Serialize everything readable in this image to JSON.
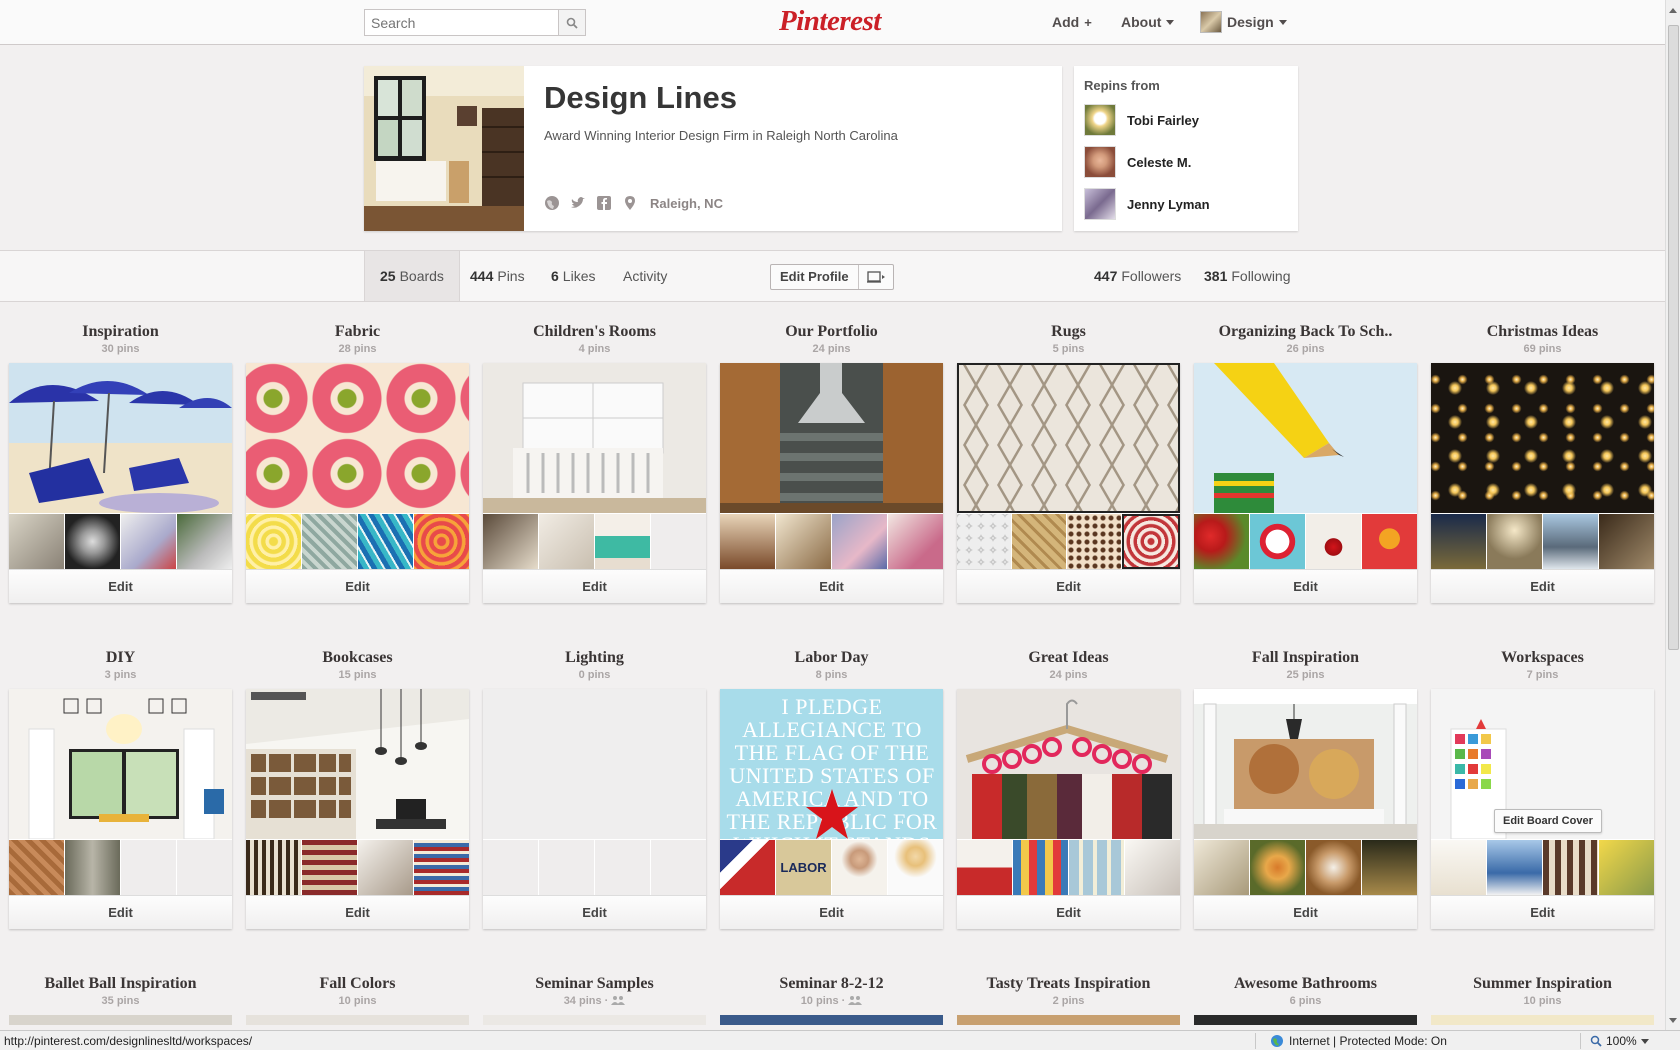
{
  "header": {
    "search_placeholder": "Search",
    "logo": "Pinterest",
    "nav_add": "Add",
    "nav_add_plus": "+",
    "nav_about": "About",
    "nav_user": "Design"
  },
  "profile": {
    "name": "Design Lines",
    "description": "Award Winning Interior Design Firm in Raleigh North Carolina",
    "location": "Raleigh, NC"
  },
  "repins": {
    "title": "Repins from",
    "users": [
      {
        "name": "Tobi Fairley"
      },
      {
        "name": "Celeste M."
      },
      {
        "name": "Jenny Lyman"
      }
    ]
  },
  "tabs": {
    "boards_count": "25",
    "boards_label": "Boards",
    "pins_count": "444",
    "pins_label": "Pins",
    "likes_count": "6",
    "likes_label": "Likes",
    "activity_label": "Activity",
    "edit_profile": "Edit Profile",
    "followers_count": "447",
    "followers_label": "Followers",
    "following_count": "381",
    "following_label": "Following"
  },
  "boards": [
    {
      "title": "Inspiration",
      "count": "30 pins",
      "edit": "Edit"
    },
    {
      "title": "Fabric",
      "count": "28 pins",
      "edit": "Edit"
    },
    {
      "title": "Children's Rooms",
      "count": "4 pins",
      "edit": "Edit"
    },
    {
      "title": "Our Portfolio",
      "count": "24 pins",
      "edit": "Edit"
    },
    {
      "title": "Rugs",
      "count": "5 pins",
      "edit": "Edit"
    },
    {
      "title": "Organizing Back To Sch..",
      "count": "26 pins",
      "edit": "Edit"
    },
    {
      "title": "Christmas Ideas",
      "count": "69 pins",
      "edit": "Edit"
    },
    {
      "title": "DIY",
      "count": "3 pins",
      "edit": "Edit"
    },
    {
      "title": "Bookcases",
      "count": "15 pins",
      "edit": "Edit"
    },
    {
      "title": "Lighting",
      "count": "0 pins",
      "edit": "Edit"
    },
    {
      "title": "Labor Day",
      "count": "8 pins",
      "edit": "Edit"
    },
    {
      "title": "Great Ideas",
      "count": "24 pins",
      "edit": "Edit"
    },
    {
      "title": "Fall Inspiration",
      "count": "25 pins",
      "edit": "Edit"
    },
    {
      "title": "Workspaces",
      "count": "7 pins",
      "edit": "Edit"
    },
    {
      "title": "Ballet Ball Inspiration",
      "count": "35 pins"
    },
    {
      "title": "Fall Colors",
      "count": "10 pins"
    },
    {
      "title": "Seminar Samples",
      "count": "34 pins ·"
    },
    {
      "title": "Seminar 8-2-12",
      "count": "10 pins ·"
    },
    {
      "title": "Tasty Treats Inspiration",
      "count": "2 pins"
    },
    {
      "title": "Awesome Bathrooms",
      "count": "6 pins"
    },
    {
      "title": "Summer Inspiration",
      "count": "10 pins"
    }
  ],
  "labor_day_poster": "I PLEDGE ALLEGIANCE TO THE FLAG OF THE UNITED STATES OF AMERICA AND TO THE REPUBLIC FOR WHICH IT STANDS",
  "labor_thumb_text": "LABOR",
  "edit_board_cover": "Edit Board Cover",
  "statusbar": {
    "url": "http://pinterest.com/designlinesltd/workspaces/",
    "zone": "Internet | Protected Mode: On",
    "zoom": "100%"
  },
  "colors": {
    "brand": "#cb2027",
    "background": "#f2f0f0"
  },
  "icons": [
    "search-icon",
    "plus-icon",
    "globe-icon",
    "twitter-icon",
    "facebook-icon",
    "location-pin-icon",
    "profile-picture-icon",
    "group-board-icon",
    "internet-globe-icon",
    "zoom-icon"
  ]
}
